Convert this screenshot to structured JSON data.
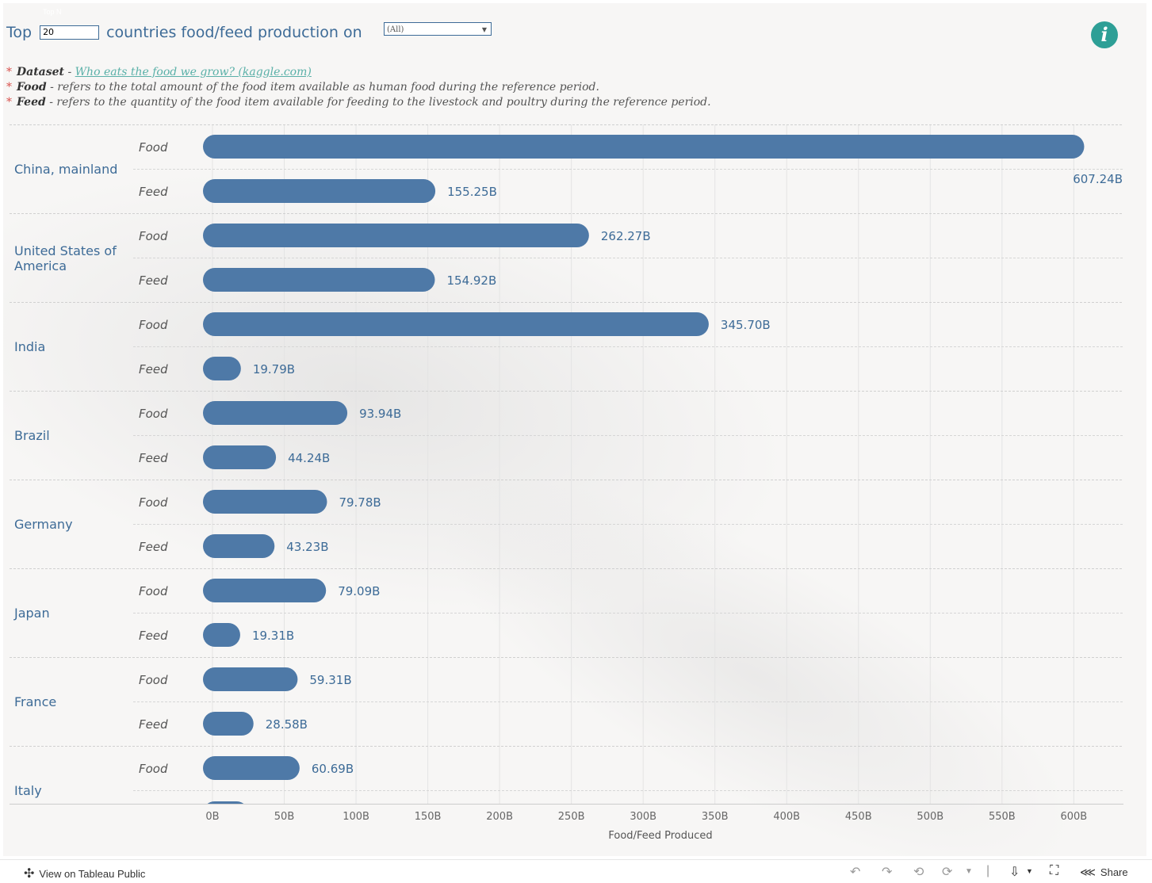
{
  "header": {
    "title_before": "Top",
    "topn_label": "Top N",
    "topn_value": "20",
    "title_after": "countries food/feed production on",
    "filter_value": "(All)"
  },
  "notes": [
    {
      "term": "Dataset",
      "sep": " - ",
      "link": "Who eats the food we grow? (kaggle.com)",
      "text": ""
    },
    {
      "term": "Food",
      "sep": " - ",
      "link": "",
      "text": "refers to the total amount of the food item available as human food during the reference period."
    },
    {
      "term": "Feed",
      "sep": " - ",
      "link": "",
      "text": "refers to the quantity of the food item available for feeding to the livestock and poultry during the reference period."
    }
  ],
  "chart_data": {
    "type": "bar",
    "orientation": "horizontal",
    "categories": [
      "China, mainland",
      "United States of America",
      "India",
      "Brazil",
      "Germany",
      "Japan",
      "France",
      "Italy"
    ],
    "subcategories": [
      "Food",
      "Feed"
    ],
    "series": [
      {
        "name": "Food",
        "values": [
          607.24,
          262.27,
          345.7,
          93.94,
          79.78,
          79.09,
          59.31,
          60.69
        ],
        "labels": [
          "607.24B",
          "262.27B",
          "345.70B",
          "93.94B",
          "79.78B",
          "79.09B",
          "59.31B",
          "60.69B"
        ]
      },
      {
        "name": "Feed",
        "values": [
          155.25,
          154.92,
          19.79,
          44.24,
          43.23,
          19.31,
          28.58,
          null
        ],
        "labels": [
          "155.25B",
          "154.92B",
          "19.79B",
          "44.24B",
          "43.23B",
          "19.31B",
          "28.58B",
          ""
        ]
      }
    ],
    "xlabel": "Food/Feed Produced",
    "xlim": [
      0,
      630
    ],
    "x_ticks": [
      0,
      50,
      100,
      150,
      200,
      250,
      300,
      350,
      400,
      450,
      500,
      550,
      600
    ],
    "x_tick_labels": [
      "0B",
      "50B",
      "100B",
      "150B",
      "200B",
      "250B",
      "300B",
      "350B",
      "400B",
      "450B",
      "500B",
      "550B",
      "600B"
    ],
    "unit": "B",
    "grid": true,
    "colors": {
      "bar": "#4e79a7",
      "text": "#3d6b97",
      "axis_text": "#666666"
    }
  },
  "footer": {
    "view_label": "View on Tableau Public",
    "share_label": "Share"
  }
}
